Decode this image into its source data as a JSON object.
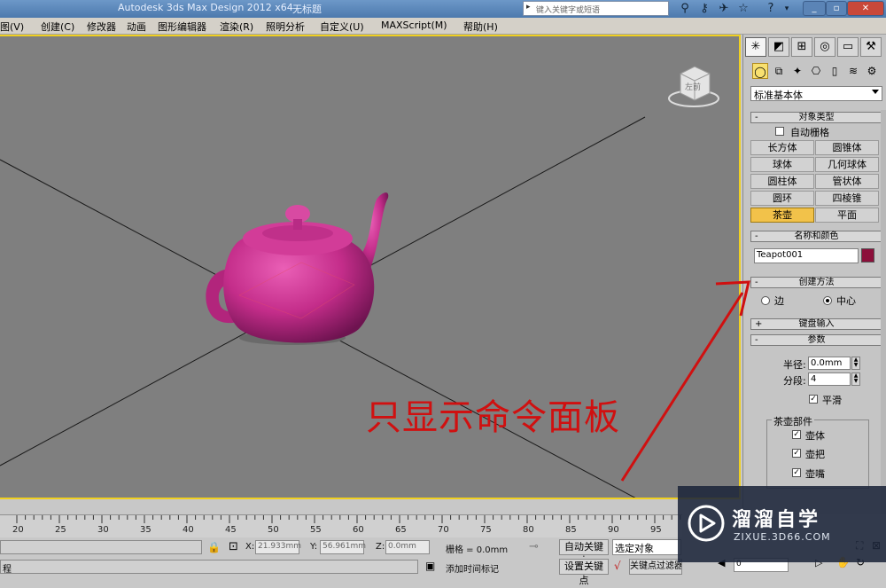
{
  "window": {
    "title": "Autodesk 3ds Max Design 2012 x64",
    "document": "无标题",
    "search_placeholder": "键入关键字或短语"
  },
  "menu": [
    "图(V)",
    "创建(C)",
    "修改器",
    "动画",
    "图形编辑器",
    "渲染(R)",
    "照明分析",
    "自定义(U)",
    "MAXScript(M)",
    "帮助(H)"
  ],
  "command_panel": {
    "tabs": [
      "create",
      "modify",
      "hierarchy",
      "motion",
      "display",
      "utilities"
    ],
    "category_value": "标准基本体",
    "object_type": {
      "header": "对象类型",
      "autogrid_label": "自动栅格",
      "buttons": [
        "长方体",
        "圆锥体",
        "球体",
        "几何球体",
        "圆柱体",
        "管状体",
        "圆环",
        "四棱锥",
        "茶壶",
        "平面"
      ],
      "active_button": "茶壶"
    },
    "name_color": {
      "header": "名称和颜色",
      "name_value": "Teapot001",
      "swatch_color": "#8c0f3a"
    },
    "creation_method": {
      "header": "创建方法",
      "options": [
        "边",
        "中心"
      ],
      "selected": "中心"
    },
    "keyboard_entry": {
      "header": "键盘输入"
    },
    "parameters": {
      "header": "参数",
      "radius_label": "半径:",
      "radius_value": "0.0mm",
      "segments_label": "分段:",
      "segments_value": "4",
      "smooth_label": "平滑",
      "parts_group": "茶壶部件",
      "parts": [
        "壶体",
        "壶把",
        "壶嘴"
      ]
    }
  },
  "viewport": {
    "background_color": "#7f7f7f",
    "teapot_color": "#c42d8a",
    "viewcube_face": "左前"
  },
  "timeline": {
    "ticks": [
      "20",
      "25",
      "30",
      "35",
      "40",
      "45",
      "50",
      "55",
      "60",
      "65",
      "70",
      "75",
      "80",
      "85",
      "90",
      "95"
    ]
  },
  "status": {
    "x_label": "X:",
    "x_value": "21.933mm",
    "y_label": "Y:",
    "y_value": "56.961mm",
    "z_label": "Z:",
    "z_value": "0.0mm",
    "grid_text": "栅格 = 0.0mm",
    "auto_key_label": "自动关键点",
    "set_key_label": "设置关键点",
    "selection_value": "选定对象",
    "key_filters_label": "关键点过滤器...",
    "add_time_tag_label": "添加时间标记",
    "prompt_text": "程",
    "frame_value": "0"
  },
  "annotation": {
    "text": "只显示命令面板",
    "color": "#d01010"
  },
  "watermark": {
    "brand": "溜溜自学",
    "url": "ZIXUE.3D66.COM"
  }
}
